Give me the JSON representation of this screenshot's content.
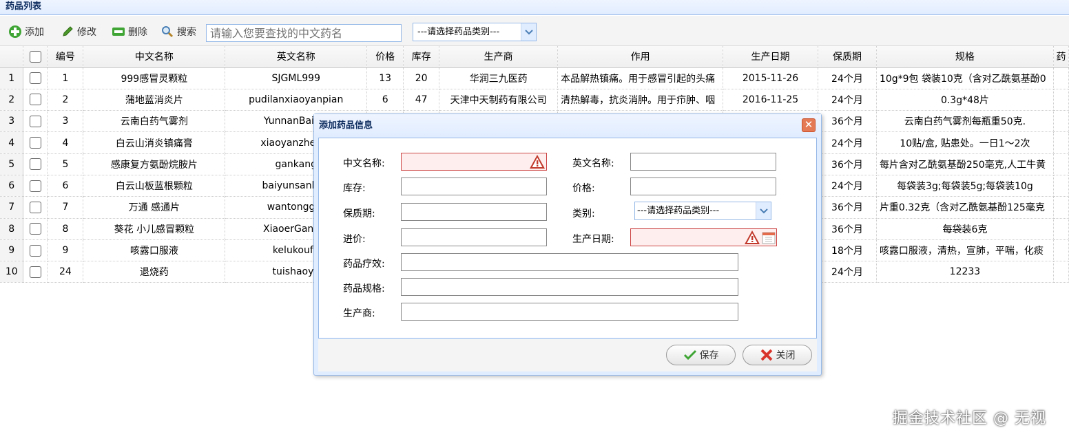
{
  "panel": {
    "title": "药品列表"
  },
  "toolbar": {
    "add_label": "添加",
    "edit_label": "修改",
    "delete_label": "删除",
    "search_label": "搜索",
    "search_placeholder": "请输入您要查找的中文药名",
    "category_select": "---请选择药品类别---"
  },
  "grid": {
    "headers": [
      "编号",
      "中文名称",
      "英文名称",
      "价格",
      "库存",
      "生产商",
      "作用",
      "生产日期",
      "保质期",
      "规格",
      "药"
    ],
    "rows": [
      {
        "rownum": "1",
        "id": "1",
        "cn_name": "999感冒灵颗粒",
        "en_name": "SJGML999",
        "price": "13",
        "stock": "20",
        "maker": "华润三九医药",
        "effect": "本品解热镇痛。用于感冒引起的头痛",
        "date": "2015-11-26",
        "shelf": "24个月",
        "spec": "10g*9包 袋装10克（含对乙酰氨基酚0"
      },
      {
        "rownum": "2",
        "id": "2",
        "cn_name": "蒲地蓝消炎片",
        "en_name": "pudilanxiaoyanpian",
        "price": "6",
        "stock": "47",
        "maker": "天津中天制药有限公司",
        "effect": "清热解毒，抗炎消肿。用于疖肿、咽",
        "date": "2016-11-25",
        "shelf": "24个月",
        "spec": "0.3g*48片"
      },
      {
        "rownum": "3",
        "id": "3",
        "cn_name": "云南白药气雾剂",
        "en_name": "YunnanBaiiya",
        "price": "",
        "stock": "",
        "maker": "",
        "effect": "",
        "date": "",
        "shelf": "36个月",
        "spec": "云南白药气雾剂每瓶重50克."
      },
      {
        "rownum": "4",
        "id": "4",
        "cn_name": "白云山消炎镇痛膏",
        "en_name": "xiaoyanzhento",
        "price": "",
        "stock": "",
        "maker": "",
        "effect": "",
        "date": "",
        "shelf": "24个月",
        "spec": "10贴/盒, 贴患处。一日1～2次"
      },
      {
        "rownum": "5",
        "id": "5",
        "cn_name": "感康复方氨酚烷胺片",
        "en_name": "gankang",
        "price": "",
        "stock": "",
        "maker": "",
        "effect": "",
        "date": "",
        "shelf": "36个月",
        "spec": "每片含对乙酰氨基酚250毫克,人工牛黄"
      },
      {
        "rownum": "6",
        "id": "6",
        "cn_name": "白云山板蓝根颗粒",
        "en_name": "baiyunsanban",
        "price": "",
        "stock": "",
        "maker": "",
        "effect": "",
        "date": "",
        "shelf": "24个月",
        "spec": "每袋装3g;每袋装5g;每袋装10g"
      },
      {
        "rownum": "7",
        "id": "7",
        "cn_name": "万通 感通片",
        "en_name": "wantonggar",
        "price": "",
        "stock": "",
        "maker": "",
        "effect": "",
        "date": "",
        "shelf": "36个月",
        "spec": "片重0.32克（含对乙酰氨基酚125毫克"
      },
      {
        "rownum": "8",
        "id": "8",
        "cn_name": "葵花 小儿感冒颗粒",
        "en_name": "XiaoerGanma",
        "price": "",
        "stock": "",
        "maker": "",
        "effect": "",
        "date": "",
        "shelf": "36个月",
        "spec": "每袋装6克"
      },
      {
        "rownum": "9",
        "id": "9",
        "cn_name": "咳露口服液",
        "en_name": "kelukoufu",
        "price": "",
        "stock": "",
        "maker": "",
        "effect": "",
        "date": "",
        "shelf": "18个月",
        "spec": "咳露口服液，清热，宣肺，平喘，化痰"
      },
      {
        "rownum": "10",
        "id": "24",
        "cn_name": "退烧药",
        "en_name": "tuishaoya",
        "price": "",
        "stock": "",
        "maker": "",
        "effect": "",
        "date": "",
        "shelf": "24个月",
        "spec": "12233"
      }
    ]
  },
  "dialog": {
    "title": "添加药品信息",
    "labels": {
      "cn_name": "中文名称:",
      "en_name": "英文名称:",
      "stock": "库存:",
      "price": "价格:",
      "shelf": "保质期:",
      "category": "类别:",
      "cost": "进价:",
      "date": "生产日期:",
      "effect": "药品疗效:",
      "spec": "药品规格:",
      "maker": "生产商:"
    },
    "category_select": "---请选择药品类别---",
    "save_label": "保存",
    "close_label": "关闭"
  },
  "watermark": "掘金技术社区 @ 无视",
  "colors": {
    "accent": "#95b8e7",
    "header_bg": "#e0ecff",
    "invalid_bg": "#ffeeee"
  }
}
